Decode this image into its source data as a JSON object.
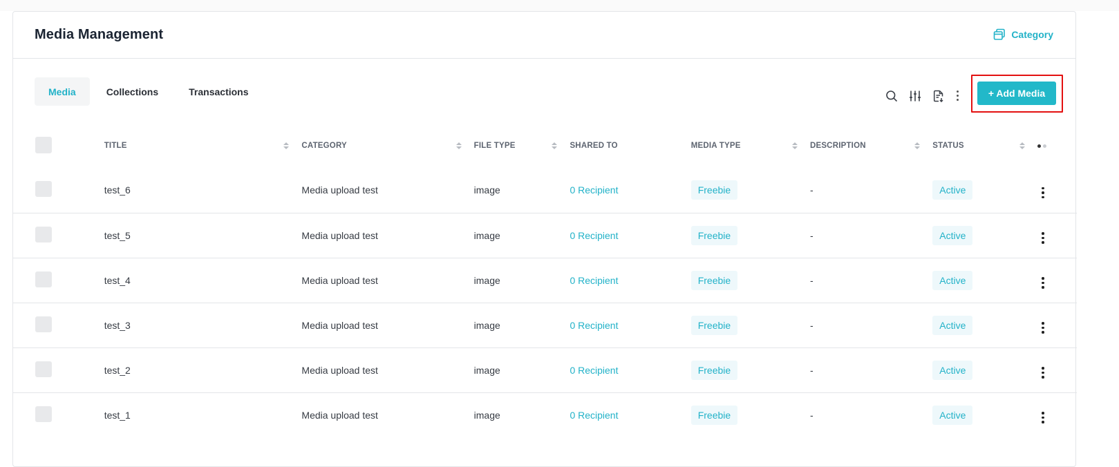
{
  "header": {
    "title": "Media Management",
    "category_link": "Category"
  },
  "tabs": [
    {
      "label": "Media",
      "active": true
    },
    {
      "label": "Collections",
      "active": false
    },
    {
      "label": "Transactions",
      "active": false
    }
  ],
  "toolbar": {
    "add_button": "+ Add Media",
    "icons": [
      "search-icon",
      "filter-sliders-icon",
      "export-document-icon",
      "more-vertical-icon"
    ]
  },
  "table": {
    "columns": [
      "TITLE",
      "CATEGORY",
      "FILE TYPE",
      "SHARED TO",
      "MEDIA TYPE",
      "DESCRIPTION",
      "STATUS"
    ],
    "rows": [
      {
        "title": "test_6",
        "category": "Media upload test",
        "file_type": "image",
        "shared_to": "0 Recipient",
        "media_type": "Freebie",
        "description": "-",
        "status": "Active"
      },
      {
        "title": "test_5",
        "category": "Media upload test",
        "file_type": "image",
        "shared_to": "0 Recipient",
        "media_type": "Freebie",
        "description": "-",
        "status": "Active"
      },
      {
        "title": "test_4",
        "category": "Media upload test",
        "file_type": "image",
        "shared_to": "0 Recipient",
        "media_type": "Freebie",
        "description": "-",
        "status": "Active"
      },
      {
        "title": "test_3",
        "category": "Media upload test",
        "file_type": "image",
        "shared_to": "0 Recipient",
        "media_type": "Freebie",
        "description": "-",
        "status": "Active"
      },
      {
        "title": "test_2",
        "category": "Media upload test",
        "file_type": "image",
        "shared_to": "0 Recipient",
        "media_type": "Freebie",
        "description": "-",
        "status": "Active"
      },
      {
        "title": "test_1",
        "category": "Media upload test",
        "file_type": "image",
        "shared_to": "0 Recipient",
        "media_type": "Freebie",
        "description": "-",
        "status": "Active"
      }
    ]
  },
  "colors": {
    "accent": "#22b8c9",
    "highlight_border": "#e31010",
    "badge_bg": "#eef8fb"
  }
}
